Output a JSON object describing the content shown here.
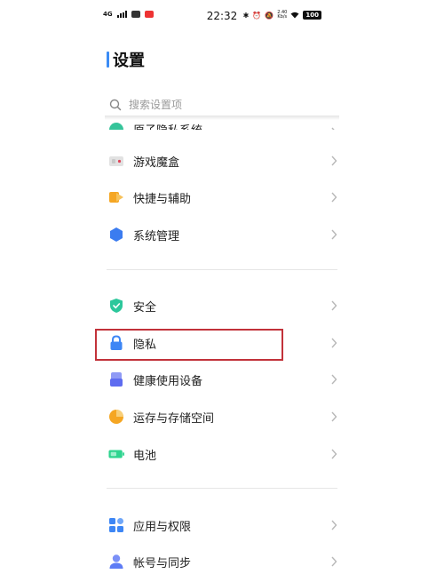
{
  "status_bar": {
    "network": "4G",
    "time": "22:32",
    "speed_value": "2.40",
    "speed_unit": "Kb/s",
    "battery": "100"
  },
  "header": {
    "title": "设置"
  },
  "search": {
    "placeholder": "搜索设置项"
  },
  "sections": [
    {
      "items": [
        {
          "label": "原子隐私系统",
          "icon": "atom-privacy-icon",
          "color": "#35c49a"
        },
        {
          "label": "游戏魔盒",
          "icon": "game-box-icon",
          "color": "#d9d9d9"
        },
        {
          "label": "快捷与辅助",
          "icon": "shortcut-icon",
          "color": "#f5a623"
        },
        {
          "label": "系统管理",
          "icon": "system-management-icon",
          "color": "#3b7cf0"
        }
      ]
    },
    {
      "items": [
        {
          "label": "安全",
          "icon": "shield-icon",
          "color": "#2cc79b"
        },
        {
          "label": "隐私",
          "icon": "lock-icon",
          "color": "#3d86f5"
        },
        {
          "label": "健康使用设备",
          "icon": "healthy-usage-icon",
          "color": "#5e6cf0"
        },
        {
          "label": "运存与存储空间",
          "icon": "storage-pie-icon",
          "color": "#f5a623"
        },
        {
          "label": "电池",
          "icon": "battery-icon",
          "color": "#2fd48f"
        }
      ]
    },
    {
      "items": [
        {
          "label": "应用与权限",
          "icon": "apps-grid-icon",
          "color": "#3d86f5"
        },
        {
          "label": "帐号与同步",
          "icon": "account-icon",
          "color": "#5e7cf5"
        }
      ]
    }
  ],
  "colors": {
    "accent": "#3b8cf5",
    "highlight_box": "#c2323a",
    "chevron": "#b8b8b8"
  }
}
